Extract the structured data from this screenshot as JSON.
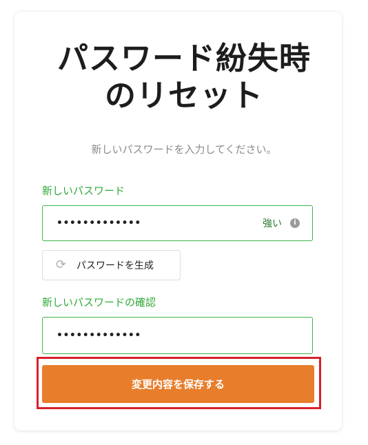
{
  "header": {
    "title_line1": "パスワード紛失時",
    "title_line2": "のリセット",
    "subtitle": "新しいパスワードを入力してください。"
  },
  "new_password": {
    "label": "新しいパスワード",
    "value": "•••••••••••••",
    "strength": "強い",
    "info_icon": "info-circle-icon"
  },
  "generate": {
    "label": "パスワードを生成",
    "icon": "refresh-icon"
  },
  "confirm_password": {
    "label": "新しいパスワードの確認",
    "value": "•••••••••••••"
  },
  "save": {
    "label": "変更内容を保存する"
  },
  "colors": {
    "accent_green": "#2fa93a",
    "save_orange": "#e87d2b",
    "highlight_red": "#d6212b"
  }
}
